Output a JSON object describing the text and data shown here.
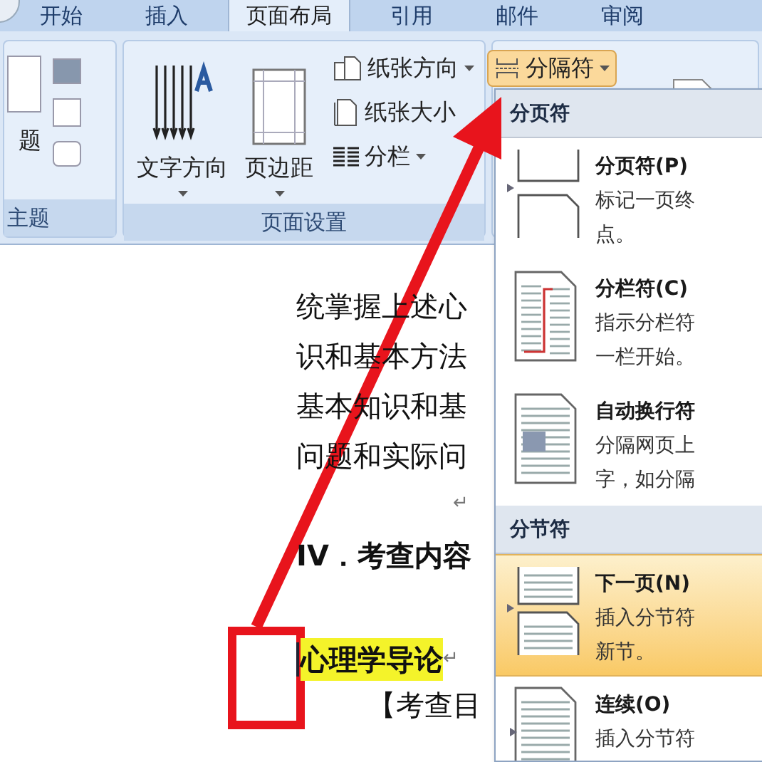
{
  "tabs": [
    {
      "label": "开始",
      "selected": false
    },
    {
      "label": "插入",
      "selected": false
    },
    {
      "label": "页面布局",
      "selected": true
    },
    {
      "label": "引用",
      "selected": false
    },
    {
      "label": "邮件",
      "selected": false
    },
    {
      "label": "审阅",
      "selected": false
    }
  ],
  "ribbon": {
    "groups": [
      {
        "label": "主题",
        "large_label": "题"
      },
      {
        "label": "页面设置",
        "buttons": [
          {
            "label": "文字方向",
            "has_dropdown": true,
            "pressed": false
          },
          {
            "label": "页边距",
            "has_dropdown": true,
            "pressed": false
          },
          {
            "label": "纸张方向",
            "has_dropdown": true,
            "pressed": false
          },
          {
            "label": "纸张大小",
            "has_dropdown": false,
            "pressed": false
          },
          {
            "label": "分栏",
            "has_dropdown": true,
            "pressed": false
          },
          {
            "label": "分隔符",
            "has_dropdown": true,
            "pressed": true
          }
        ]
      }
    ]
  },
  "document": {
    "lines": [
      {
        "kind": "body",
        "text": "统掌握上述心"
      },
      {
        "kind": "body",
        "text": "识和基本方法"
      },
      {
        "kind": "body",
        "text": "基本知识和基"
      },
      {
        "kind": "body",
        "text": "问题和实际问"
      },
      {
        "kind": "mark",
        "text": "↵"
      },
      {
        "kind": "heading",
        "text": "IV．考查内容"
      },
      {
        "kind": "highlight",
        "text": "心理学导论",
        "mark": "↵"
      },
      {
        "kind": "indent",
        "text": "【考查目"
      }
    ]
  },
  "breaks_menu": {
    "sections": [
      {
        "title": "分页符",
        "items": [
          {
            "kind": "page",
            "label": "分页符(P)",
            "description": [
              "标记一页终",
              "点。"
            ],
            "selected": false
          },
          {
            "kind": "column",
            "label": "分栏符(C)",
            "description": [
              "指示分栏符",
              "一栏开始。"
            ],
            "selected": false
          },
          {
            "kind": "wrap",
            "label": "自动换行符",
            "description": [
              "分隔网页上",
              "字，如分隔"
            ],
            "selected": false
          }
        ]
      },
      {
        "title": "分节符",
        "items": [
          {
            "kind": "next-page",
            "label": "下一页(N)",
            "description": [
              "插入分节符",
              "新节。"
            ],
            "selected": true
          },
          {
            "kind": "continuous",
            "label": "连续(O)",
            "description": [
              "插入分节符"
            ],
            "selected": false
          }
        ]
      }
    ]
  }
}
